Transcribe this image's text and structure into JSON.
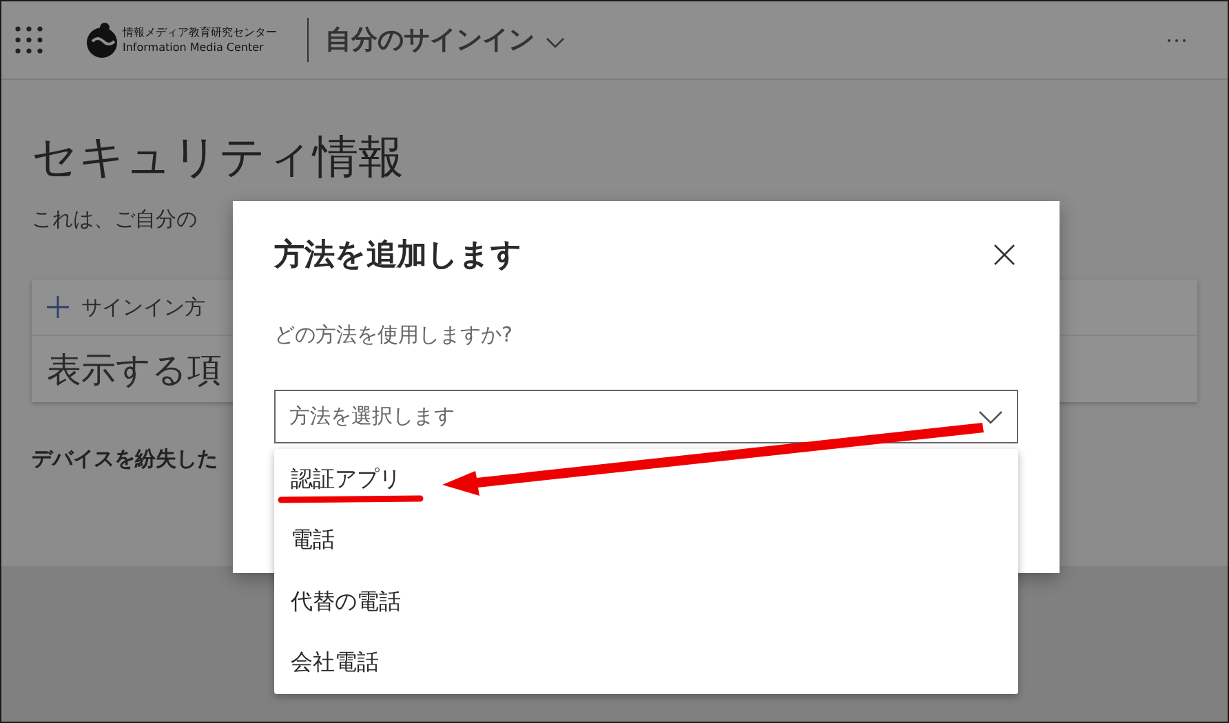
{
  "header": {
    "logo_lines": [
      "情報メディア教育研究センター",
      "Information Media Center"
    ],
    "title": "自分のサインイン"
  },
  "page": {
    "heading": "セキュリティ情報",
    "description": "これは、ご自分の",
    "add_method": "サインイン方",
    "empty_list": "表示する項",
    "lost_device": "デバイスを紛失した"
  },
  "dialog": {
    "title": "方法を追加します",
    "question": "どの方法を使用しますか?",
    "select": {
      "placeholder": "方法を選択します"
    },
    "options": [
      {
        "label": "認証アプリ",
        "selected": false
      },
      {
        "label": "電話",
        "selected": false
      },
      {
        "label": "代替の電話",
        "selected": false
      },
      {
        "label": "会社電話",
        "selected": false
      }
    ]
  }
}
